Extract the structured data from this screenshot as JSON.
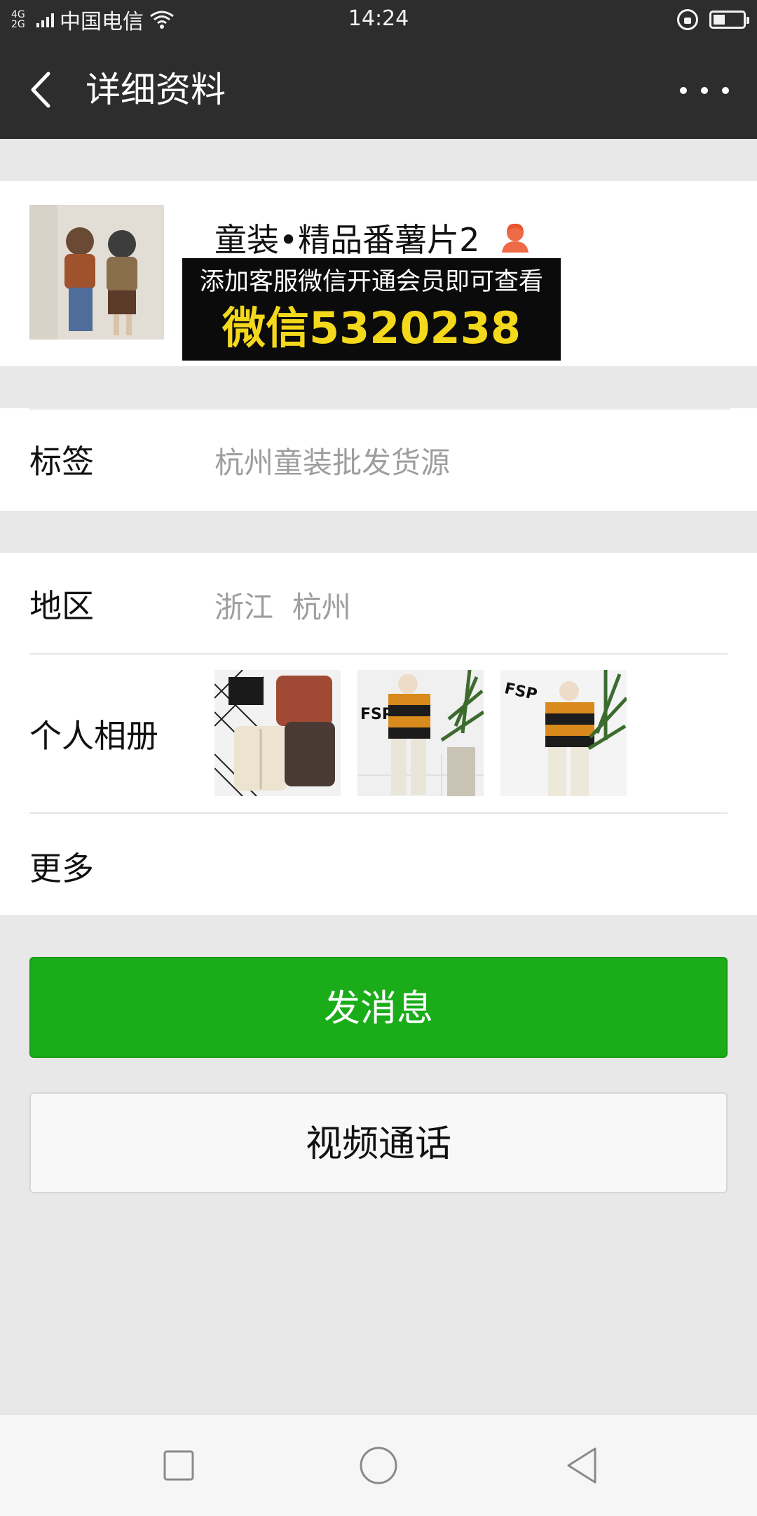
{
  "status_bar": {
    "network": "4G\n2G",
    "carrier": "中国电信",
    "time": "14:24",
    "battery_level": 0.4
  },
  "header": {
    "title": "详细资料",
    "back_icon": "chevron-left-icon",
    "more_icon": "more-dots-icon"
  },
  "profile": {
    "nickname": "童装•精品番薯片2",
    "gender_icon": "female-user-icon",
    "watermark_line1": "添加客服微信开通会员即可查看",
    "watermark_line2": "微信5320238",
    "accent_color": "#f4d81c"
  },
  "tags": {
    "label": "标签",
    "value": "杭州童装批发货源"
  },
  "region": {
    "label": "地区",
    "value": "浙江  杭州"
  },
  "album": {
    "label": "个人相册",
    "thumbnails": [
      "sweater-photo",
      "kids-striped-sweater-photo",
      "kids-striped-sweater-photo-2"
    ]
  },
  "more": {
    "label": "更多"
  },
  "actions": {
    "send_message": "发消息",
    "video_call": "视频通话",
    "primary_color": "#1aad19"
  },
  "nav_bar": {
    "icons": [
      "recent-apps-icon",
      "home-icon",
      "back-icon"
    ]
  }
}
